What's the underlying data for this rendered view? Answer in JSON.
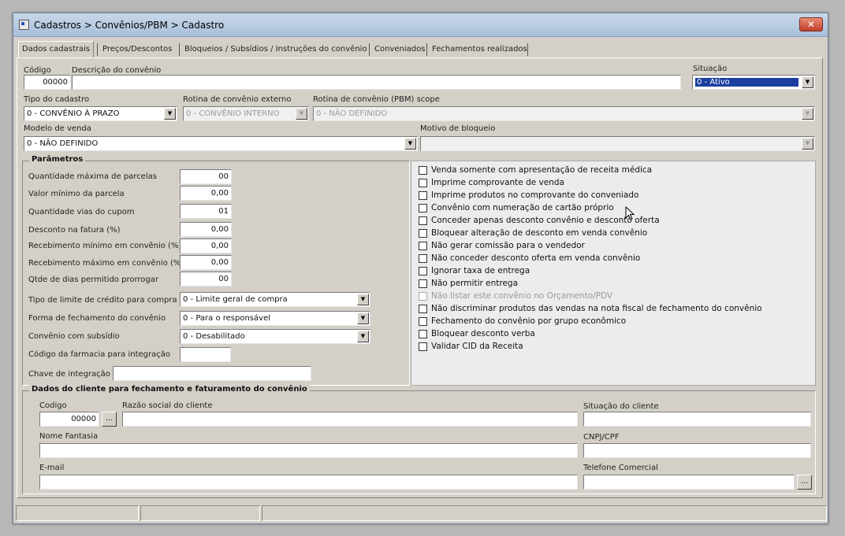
{
  "window": {
    "title": "Cadastros > Convênios/PBM > Cadastro",
    "close_label": "✕"
  },
  "tabs": [
    {
      "label": "Dados cadastrais"
    },
    {
      "label": "Preços/Descontos"
    },
    {
      "label": "Bloqueios / Subsídios / Instruções do convênio"
    },
    {
      "label": "Conveniados"
    },
    {
      "label": "Fechamentos realizados"
    }
  ],
  "top": {
    "codigo_label": "Código",
    "codigo_value": "00000",
    "descricao_label": "Descrição do convênio",
    "descricao_value": "",
    "situacao_label": "Situação",
    "situacao_value": "0 - Ativo",
    "tipo_label": "Tipo do cadastro",
    "tipo_value": "0 - CONVÊNIO À PRAZO",
    "rotina_ext_label": "Rotina de convênio externo",
    "rotina_ext_value": "0 - CONVÊNIO INTERNO",
    "rotina_pbm_label": "Rotina de convênio (PBM) scope",
    "rotina_pbm_value": "0 - NÃO DEFINIDO",
    "modelo_label": "Modelo de venda",
    "modelo_value": "0 - NÃO DEFINIDO",
    "motivo_label": "Motivo de bloqueio",
    "motivo_value": ""
  },
  "parametros": {
    "title": "Parâmetros",
    "rows": [
      {
        "label": "Quantidade máxima de parcelas",
        "value": "00"
      },
      {
        "label": "Valor mínimo da parcela",
        "value": "0,00"
      },
      {
        "label": "Quantidade vias do cupom",
        "value": "01"
      },
      {
        "label": "Desconto na fatura (%)",
        "value": "0,00"
      },
      {
        "label": "Recebimento mínimo em convênio (%)",
        "value": "0,00"
      },
      {
        "label": "Recebimento máximo em convênio (%)",
        "value": "0,00"
      },
      {
        "label": "Qtde de dias permitido prorrogar",
        "value": "00"
      }
    ],
    "limite_label": "Tipo de limite de crédito para compra",
    "limite_value": "0 - Limite geral de compra",
    "forma_label": "Forma de fechamento do convênio",
    "forma_value": "0 - Para o responsável",
    "subsidio_label": "Convênio com subsídio",
    "subsidio_value": "0 - Desabilitado",
    "farmacia_label": "Código da farmacia para integração",
    "farmacia_value": "",
    "chave_label": "Chave de integração",
    "chave_value": ""
  },
  "checkboxes": [
    {
      "label": "Venda somente com apresentação de receita médica",
      "checked": false,
      "enabled": true
    },
    {
      "label": "Imprime comprovante de venda",
      "checked": false,
      "enabled": true
    },
    {
      "label": "Imprime produtos no comprovante do conveniado",
      "checked": false,
      "enabled": true
    },
    {
      "label": "Convênio com numeração de cartão próprio",
      "checked": false,
      "enabled": true
    },
    {
      "label": "Conceder apenas desconto convênio e desconto oferta",
      "checked": false,
      "enabled": true
    },
    {
      "label": "Bloquear alteração de desconto em venda convênio",
      "checked": false,
      "enabled": true
    },
    {
      "label": "Não gerar comissão para o vendedor",
      "checked": false,
      "enabled": true
    },
    {
      "label": "Não conceder desconto oferta em venda convênio",
      "checked": false,
      "enabled": true
    },
    {
      "label": "Ignorar taxa de entrega",
      "checked": false,
      "enabled": true
    },
    {
      "label": "Não permitir entrega",
      "checked": false,
      "enabled": true
    },
    {
      "label": "Não listar este convênio no Orçamento/PDV",
      "checked": false,
      "enabled": false
    },
    {
      "label": "Não discriminar produtos das vendas na nota fiscal de fechamento do convênio",
      "checked": false,
      "enabled": true
    },
    {
      "label": "Fechamento do convênio por grupo econômico",
      "checked": false,
      "enabled": true
    },
    {
      "label": "Bloquear desconto verba",
      "checked": false,
      "enabled": true
    },
    {
      "label": "Validar CID da Receita",
      "checked": false,
      "enabled": true
    }
  ],
  "cliente": {
    "title": "Dados do cliente para fechamento e faturamento do convênio",
    "codigo_label": "Codigo",
    "codigo_value": "00000",
    "ellipsis": "...",
    "razao_label": "Razão social do cliente",
    "razao_value": "",
    "situacao_label": "Situação do cliente",
    "situacao_value": "",
    "fantasia_label": "Nome Fantasia",
    "fantasia_value": "",
    "cnpj_label": "CNPJ/CPF",
    "cnpj_value": "",
    "email_label": "E-mail",
    "email_value": "",
    "telefone_label": "Telefone Comercial",
    "telefone_value": ""
  },
  "colors": {
    "selection": "#1a3f9e",
    "window_bg": "#d4d0c8",
    "titlebar": "#b5c9e0"
  },
  "icons": {
    "dropdown": "▼",
    "close": "close-icon",
    "cursor": "mouse-pointer-icon"
  }
}
